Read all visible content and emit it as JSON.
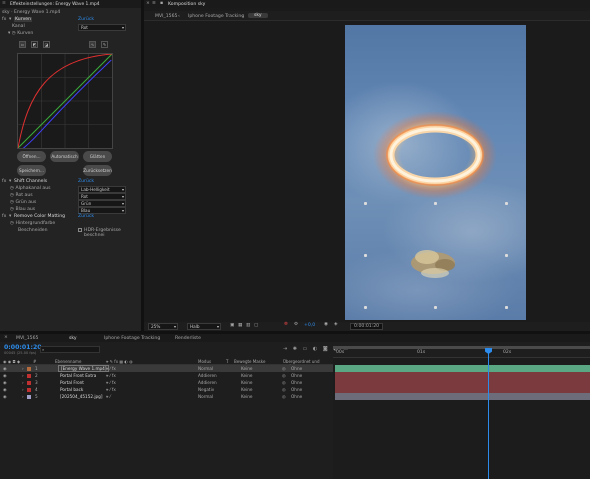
{
  "effect_controls": {
    "title": "Effekteinstellungen: Energy Wave 1.mp4",
    "layer_path": "sky · Energy Wave 1.mp4",
    "curves": {
      "fx_name": "Kurven",
      "reset": "Zurück",
      "channel_label": "Kanal",
      "channel_value": "Rot",
      "curves_label": "Kurven",
      "btn_open": "Öffnen...",
      "btn_auto": "Automatisch",
      "btn_smooth": "Glätten",
      "btn_save": "Speichern...",
      "btn_reset": "Zurücksetzen"
    },
    "shift_channels": {
      "fx_name": "Shift Channels",
      "reset": "Zurück",
      "rows": [
        {
          "label": "Alphakanal aus",
          "value": "Lab-Helligkeit"
        },
        {
          "label": "Rot aus",
          "value": "Rot"
        },
        {
          "label": "Grün aus",
          "value": "Grün"
        },
        {
          "label": "Blau aus",
          "value": "Blau"
        }
      ]
    },
    "remove_matting": {
      "fx_name": "Remove Color Matting",
      "reset": "Zurück",
      "bg_label": "Hintergrundfarbe",
      "clip_label": "Beschneiden",
      "hdr_label": "HDR-Ergebnisse beschnei"
    }
  },
  "composition": {
    "panel_title": "Komposition sky",
    "breadcrumbs": [
      "MVI_1565",
      "Iphone Footage Tracking",
      "sky"
    ],
    "zoom": "25%",
    "quality": "Halb",
    "timecode": "0:00:01:20"
  },
  "timeline": {
    "tabs": [
      "MVI_1565",
      "sky",
      "Iphone Footage Tracking",
      "Renderliste"
    ],
    "active_tab": 1,
    "timecode": "0:00:01:20",
    "frame_info": "00045 (25.00 fps)",
    "header": {
      "source_name": "Ebenenname",
      "mode": "Modus",
      "t": "T",
      "trkmat": "Bewegte Maske",
      "parent": "Übergeordnet und verkn."
    },
    "layers": [
      {
        "num": "1",
        "name": "[Energy Wave 1.mp4]",
        "mode": "Normal",
        "matte": "Keine",
        "parent": "Ohne",
        "color": "#b36b3d",
        "selected": true
      },
      {
        "num": "2",
        "name": "Portal Front Extra",
        "mode": "Addieren",
        "matte": "Keine",
        "parent": "Ohne",
        "color": "#c03030",
        "selected": false
      },
      {
        "num": "3",
        "name": "Portal Front",
        "mode": "Addieren",
        "matte": "Keine",
        "parent": "Ohne",
        "color": "#c03030",
        "selected": false
      },
      {
        "num": "4",
        "name": "Portal back",
        "mode": "Negativ",
        "matte": "Keine",
        "parent": "Ohne",
        "color": "#c03030",
        "selected": false
      },
      {
        "num": "5",
        "name": "[202504_45152.jpg]",
        "mode": "Normal",
        "matte": "Keine",
        "parent": "Ohne",
        "color": "#a0a0c8",
        "selected": false
      }
    ],
    "ruler": [
      "00s",
      "01s",
      "02s"
    ]
  }
}
